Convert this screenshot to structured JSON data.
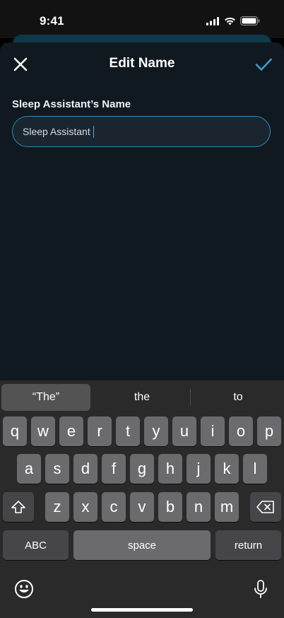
{
  "status_bar": {
    "time": "9:41"
  },
  "header": {
    "title": "Edit Name"
  },
  "form": {
    "label": "Sleep Assistant’s Name",
    "value": "Sleep Assistant"
  },
  "keyboard": {
    "suggestions": [
      "“The”",
      "the",
      "to"
    ],
    "row1": [
      "q",
      "w",
      "e",
      "r",
      "t",
      "y",
      "u",
      "i",
      "o",
      "p"
    ],
    "row2": [
      "a",
      "s",
      "d",
      "f",
      "g",
      "h",
      "j",
      "k",
      "l"
    ],
    "row3": [
      "z",
      "x",
      "c",
      "v",
      "b",
      "n",
      "m"
    ],
    "abc_label": "ABC",
    "space_label": "space",
    "return_label": "return"
  },
  "icons": {
    "close": "close-icon",
    "confirm": "checkmark-icon",
    "shift": "shift-icon",
    "delete": "backspace-icon",
    "emoji": "emoji-icon",
    "mic": "microphone-icon"
  },
  "colors": {
    "accent": "#2c8db1",
    "check": "#3a9fd0"
  }
}
